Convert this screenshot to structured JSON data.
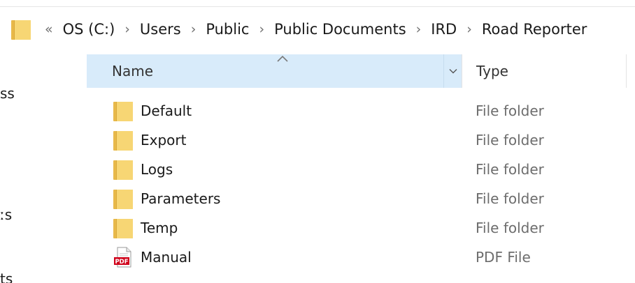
{
  "address_bar": {
    "overflow": "«",
    "crumbs": [
      "OS (C:)",
      "Users",
      "Public",
      "Public Documents",
      "IRD",
      "Road Reporter"
    ],
    "separator": "›"
  },
  "left_nav": {
    "fragments": [
      "ss",
      "ːs",
      "ts"
    ]
  },
  "columns": {
    "name": "Name",
    "type": "Type"
  },
  "files": [
    {
      "name": "Default",
      "type": "File folder",
      "icon": "folder-icon"
    },
    {
      "name": "Export",
      "type": "File folder",
      "icon": "folder-icon"
    },
    {
      "name": "Logs",
      "type": "File folder",
      "icon": "folder-icon"
    },
    {
      "name": "Parameters",
      "type": "File folder",
      "icon": "folder-icon"
    },
    {
      "name": "Temp",
      "type": "File folder",
      "icon": "folder-icon"
    },
    {
      "name": "Manual",
      "type": "PDF File",
      "icon": "pdf-icon"
    }
  ],
  "colors": {
    "header_selected": "#d8ebfa",
    "folder_front": "#f7d674",
    "folder_back": "#e8b94a",
    "pdf_red": "#d0021b",
    "type_text": "#6d6d6d"
  },
  "pdf_icon_text": "PDF"
}
